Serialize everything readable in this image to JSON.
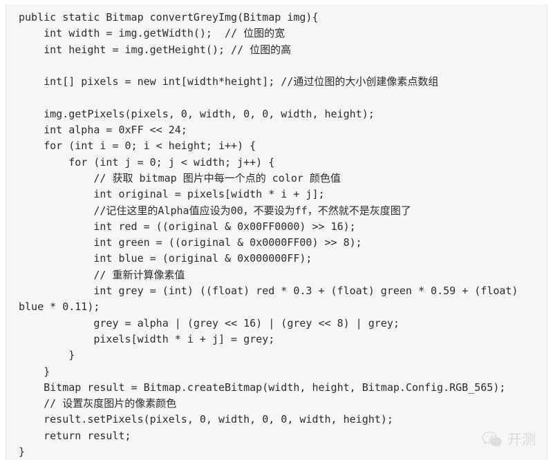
{
  "code_block": {
    "language": "java",
    "background_color": "#f6f6f6",
    "text_color": "#2b2b2b",
    "lines": [
      "public static Bitmap convertGreyImg(Bitmap img){",
      "    int width = img.getWidth();  // 位图的宽",
      "    int height = img.getHeight(); // 位图的高",
      "",
      "    int[] pixels = new int[width*height]; //通过位图的大小创建像素点数组",
      "",
      "    img.getPixels(pixels, 0, width, 0, 0, width, height);",
      "    int alpha = 0xFF << 24;",
      "    for (int i = 0; i < height; i++) {",
      "        for (int j = 0; j < width; j++) {",
      "            // 获取 bitmap 图片中每一个点的 color 颜色值",
      "            int original = pixels[width * i + j];",
      "            //记住这里的Alpha值应设为00，不要设为ff，不然就不是灰度图了",
      "            int red = ((original & 0x00FF0000) >> 16);",
      "            int green = ((original & 0x0000FF00) >> 8);",
      "            int blue = (original & 0x000000FF);",
      "            // 重新计算像素值",
      "            int grey = (int) ((float) red * 0.3 + (float) green * 0.59 + (float) blue * 0.11);",
      "            grey = alpha | (grey << 16) | (grey << 8) | grey;",
      "            pixels[width * i + j] = grey;",
      "        }",
      "    }",
      "    Bitmap result = Bitmap.createBitmap(width, height, Bitmap.Config.RGB_565);",
      "    // 设置灰度图片的像素颜色",
      "    result.setPixels(pixels, 0, width, 0, 0, width, height);",
      "    return result;",
      "}"
    ]
  },
  "watermark": {
    "icon": "wechat-logo-icon",
    "label": "开测",
    "color": "#d9d9dd"
  }
}
